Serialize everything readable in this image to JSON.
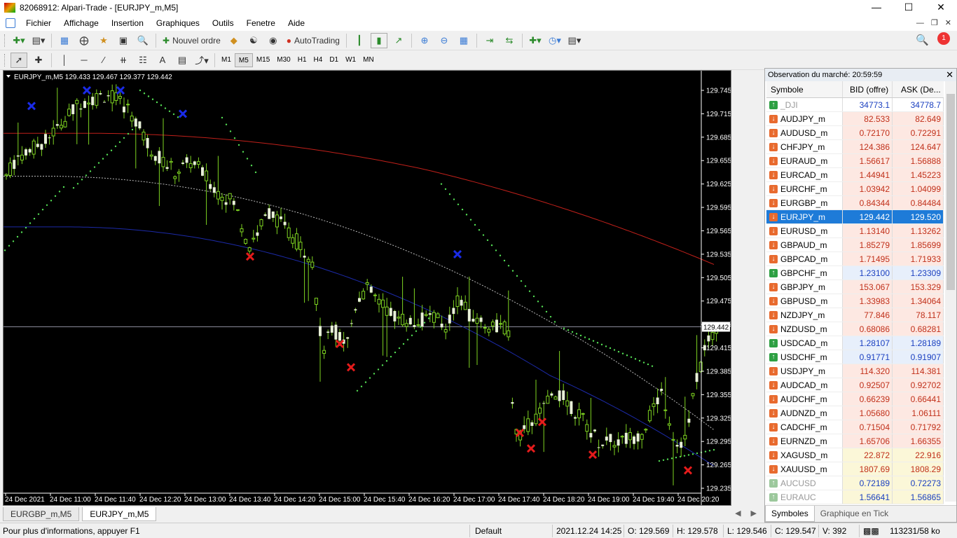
{
  "window": {
    "title": "82068912: Alpari-Trade - [EURJPY_m,M5]"
  },
  "menu": [
    "Fichier",
    "Affichage",
    "Insertion",
    "Graphiques",
    "Outils",
    "Fenetre",
    "Aide"
  ],
  "toolbar": {
    "new_order": "Nouvel ordre",
    "autotrading": "AutoTrading",
    "timeframes": [
      "M1",
      "M5",
      "M15",
      "M30",
      "H1",
      "H4",
      "D1",
      "W1",
      "MN"
    ],
    "selected_timeframe": "M5",
    "alerts_count": "1"
  },
  "chart": {
    "header": "EURJPY_m,M5  129.433 129.467 129.377 129.442",
    "current_price": "129.442",
    "price_levels": [
      "129.745",
      "129.715",
      "129.685",
      "129.655",
      "129.625",
      "129.595",
      "129.565",
      "129.535",
      "129.505",
      "129.475",
      "129.445",
      "129.415",
      "129.385",
      "129.355",
      "129.325",
      "129.295",
      "129.265",
      "129.235"
    ],
    "time_labels": [
      "24 Dec 2021",
      "24 Dec 11:00",
      "24 Dec 11:40",
      "24 Dec 12:20",
      "24 Dec 13:00",
      "24 Dec 13:40",
      "24 Dec 14:20",
      "24 Dec 15:00",
      "24 Dec 15:40",
      "24 Dec 16:20",
      "24 Dec 17:00",
      "24 Dec 17:40",
      "24 Dec 18:20",
      "24 Dec 19:00",
      "24 Dec 19:40",
      "24 Dec 20:20"
    ],
    "colors": {
      "background": "#000000",
      "candle": "#7ed321",
      "red_ma": "#c0201a",
      "blue_ma": "#1c2aa8",
      "dotted_ma": "#bbbbbb",
      "sar": "#55e055",
      "sell_mark": "#1a2be8",
      "buy_mark": "#e41b1b"
    }
  },
  "chart_tabs": [
    "EURGBP_m,M5",
    "EURJPY_m,M5"
  ],
  "active_chart_tab": "EURJPY_m,M5",
  "market_watch": {
    "title": "Observation du marché: 20:59:59",
    "headers": [
      "Symbole",
      "BID (offre)",
      "ASK (De..."
    ],
    "rows": [
      {
        "symbol": "_DJI",
        "bid": "34773.1",
        "ask": "34778.7",
        "dir": "up",
        "style": "grey"
      },
      {
        "symbol": "AUDJPY_m",
        "bid": "82.533",
        "ask": "82.649",
        "dir": "down",
        "style": "pink"
      },
      {
        "symbol": "AUDUSD_m",
        "bid": "0.72170",
        "ask": "0.72291",
        "dir": "down",
        "style": "pink"
      },
      {
        "symbol": "CHFJPY_m",
        "bid": "124.386",
        "ask": "124.647",
        "dir": "down",
        "style": "pink"
      },
      {
        "symbol": "EURAUD_m",
        "bid": "1.56617",
        "ask": "1.56888",
        "dir": "down",
        "style": "pink"
      },
      {
        "symbol": "EURCAD_m",
        "bid": "1.44941",
        "ask": "1.45223",
        "dir": "down",
        "style": "pink"
      },
      {
        "symbol": "EURCHF_m",
        "bid": "1.03942",
        "ask": "1.04099",
        "dir": "down",
        "style": "pink"
      },
      {
        "symbol": "EURGBP_m",
        "bid": "0.84344",
        "ask": "0.84484",
        "dir": "down",
        "style": "pink"
      },
      {
        "symbol": "EURJPY_m",
        "bid": "129.442",
        "ask": "129.520",
        "dir": "down",
        "style": "selected"
      },
      {
        "symbol": "EURUSD_m",
        "bid": "1.13140",
        "ask": "1.13262",
        "dir": "down",
        "style": "pink"
      },
      {
        "symbol": "GBPAUD_m",
        "bid": "1.85279",
        "ask": "1.85699",
        "dir": "down",
        "style": "pink"
      },
      {
        "symbol": "GBPCAD_m",
        "bid": "1.71495",
        "ask": "1.71933",
        "dir": "down",
        "style": "pink"
      },
      {
        "symbol": "GBPCHF_m",
        "bid": "1.23100",
        "ask": "1.23309",
        "dir": "up",
        "style": "blue"
      },
      {
        "symbol": "GBPJPY_m",
        "bid": "153.067",
        "ask": "153.329",
        "dir": "down",
        "style": "pink"
      },
      {
        "symbol": "GBPUSD_m",
        "bid": "1.33983",
        "ask": "1.34064",
        "dir": "down",
        "style": "pink"
      },
      {
        "symbol": "NZDJPY_m",
        "bid": "77.846",
        "ask": "78.117",
        "dir": "down",
        "style": "pink"
      },
      {
        "symbol": "NZDUSD_m",
        "bid": "0.68086",
        "ask": "0.68281",
        "dir": "down",
        "style": "pink"
      },
      {
        "symbol": "USDCAD_m",
        "bid": "1.28107",
        "ask": "1.28189",
        "dir": "up",
        "style": "blue"
      },
      {
        "symbol": "USDCHF_m",
        "bid": "0.91771",
        "ask": "0.91907",
        "dir": "up",
        "style": "blue"
      },
      {
        "symbol": "USDJPY_m",
        "bid": "114.320",
        "ask": "114.381",
        "dir": "down",
        "style": "pink"
      },
      {
        "symbol": "AUDCAD_m",
        "bid": "0.92507",
        "ask": "0.92702",
        "dir": "down",
        "style": "pink"
      },
      {
        "symbol": "AUDCHF_m",
        "bid": "0.66239",
        "ask": "0.66441",
        "dir": "down",
        "style": "pink"
      },
      {
        "symbol": "AUDNZD_m",
        "bid": "1.05680",
        "ask": "1.06111",
        "dir": "down",
        "style": "pink"
      },
      {
        "symbol": "CADCHF_m",
        "bid": "0.71504",
        "ask": "0.71792",
        "dir": "down",
        "style": "pink"
      },
      {
        "symbol": "EURNZD_m",
        "bid": "1.65706",
        "ask": "1.66355",
        "dir": "down",
        "style": "pink"
      },
      {
        "symbol": "XAGUSD_m",
        "bid": "22.872",
        "ask": "22.916",
        "dir": "down",
        "style": "yellow"
      },
      {
        "symbol": "XAUUSD_m",
        "bid": "1807.69",
        "ask": "1808.29",
        "dir": "down",
        "style": "yellow"
      },
      {
        "symbol": "AUCUSD",
        "bid": "0.72189",
        "ask": "0.72273",
        "dir": "na",
        "style": "greyy"
      },
      {
        "symbol": "EURAUC",
        "bid": "1.56641",
        "ask": "1.56865",
        "dir": "na",
        "style": "greyy"
      }
    ],
    "tabs": [
      "Symboles",
      "Graphique en Tick"
    ]
  },
  "status": {
    "help": "Pour plus d'informations, appuyer F1",
    "profile": "Default",
    "datetime": "2021.12.24 14:25",
    "open": "O: 129.569",
    "high": "H: 129.578",
    "low": "L: 129.546",
    "close": "C: 129.547",
    "volume": "V: 392",
    "traffic": "113231/58 ko"
  }
}
